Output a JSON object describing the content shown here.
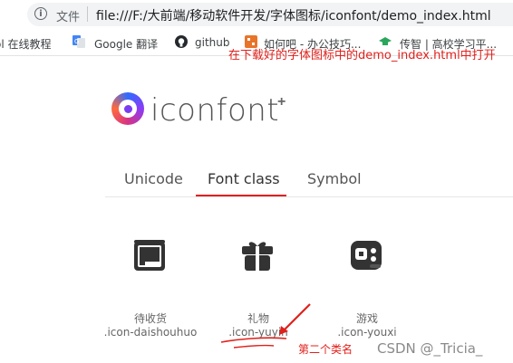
{
  "address_bar": {
    "file_label": "文件",
    "url": "file:///F:/大前端/移动软件开发/字体图标/iconfont/demo_index.html"
  },
  "bookmarks": [
    {
      "label": "ol 在线教程",
      "icon": "partial-bookmark-icon"
    },
    {
      "label": "Google 翻译",
      "icon": "google-translate-icon"
    },
    {
      "label": "github",
      "icon": "github-icon"
    },
    {
      "label": "如何吧 - 办公技巧...",
      "icon": "orange-tile-icon"
    },
    {
      "label": "传智 | 高校学习平...",
      "icon": "graduation-cap-icon"
    }
  ],
  "logo": {
    "text": "iconfont",
    "plus": "+"
  },
  "tabs": [
    {
      "label": "Unicode",
      "active": false
    },
    {
      "label": "Font class",
      "active": true
    },
    {
      "label": "Symbol",
      "active": false
    }
  ],
  "icons": [
    {
      "name": "待收货",
      "class_name": ".icon-daishouhuo",
      "icon": "package-icon"
    },
    {
      "name": "礼物",
      "class_name": ".icon-yuyin",
      "icon": "gift-icon"
    },
    {
      "name": "游戏",
      "class_name": ".icon-youxi",
      "icon": "gamepad-icon"
    }
  ],
  "annotations": {
    "top_note": "在下载好的字体图标中的demo_index.html中打开",
    "second_class_note": "第二个类名"
  },
  "watermark": "CSDN @_Tricia_",
  "colors": {
    "accent_red": "#e02020",
    "annotation_red": "#e0201b"
  }
}
